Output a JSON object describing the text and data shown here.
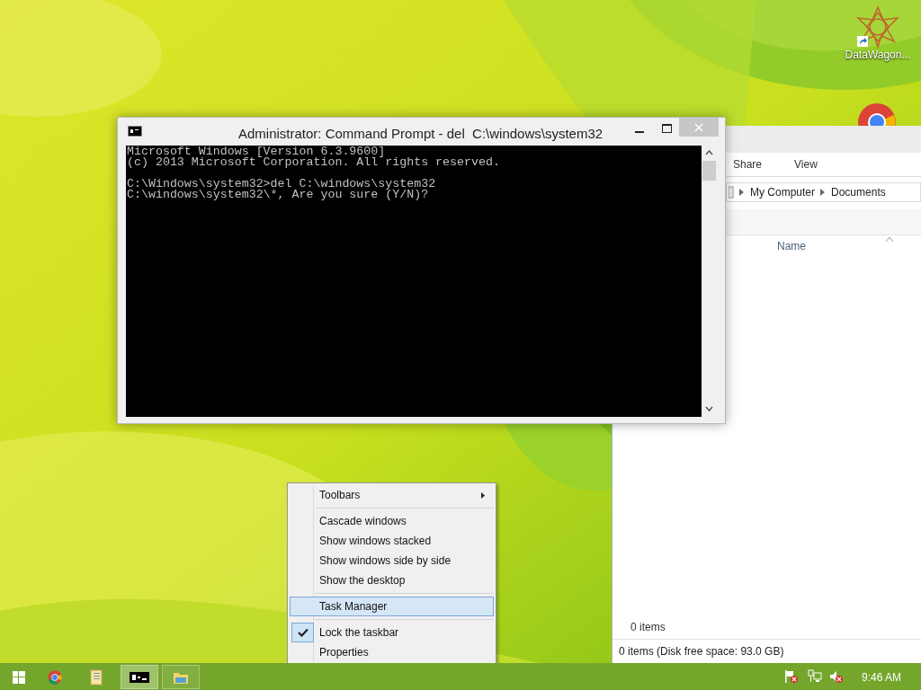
{
  "desktop": {
    "icons": [
      {
        "kind": "datawagon",
        "label": "DataWagon..."
      },
      {
        "kind": "chrome"
      }
    ]
  },
  "cmd_window": {
    "title": "Administrator: Command Prompt - del  C:\\windows\\system32",
    "blocks": [
      [
        "Microsoft Windows [Version 6.3.9600]",
        "(c) 2013 Microsoft Corporation. All rights reserved."
      ],
      [
        "C:\\Windows\\system32>del C:\\windows\\system32",
        "C:\\windows\\system32\\*, Are you sure (Y/N)?"
      ]
    ]
  },
  "explorer_window": {
    "ribbon_tabs": [
      {
        "label": "Share",
        "selected": false
      },
      {
        "label": "View",
        "selected": false
      }
    ],
    "breadcrumb": [
      "My Computer",
      "Documents"
    ],
    "column_header": "Name",
    "item_count": "0 items",
    "status_bar": "0 items (Disk free space: 93.0 GB)"
  },
  "context_menu": {
    "items": [
      {
        "kind": "submenu",
        "label": "Toolbars",
        "selected": false,
        "checked": false
      },
      {
        "kind": "separator"
      },
      {
        "kind": "item",
        "label": "Cascade windows",
        "selected": false,
        "checked": false
      },
      {
        "kind": "item",
        "label": "Show windows stacked",
        "selected": false,
        "checked": false
      },
      {
        "kind": "item",
        "label": "Show windows side by side",
        "selected": false,
        "checked": false
      },
      {
        "kind": "item",
        "label": "Show the desktop",
        "selected": false,
        "checked": false
      },
      {
        "kind": "separator"
      },
      {
        "kind": "item",
        "label": "Task Manager",
        "selected": true,
        "checked": false
      },
      {
        "kind": "separator"
      },
      {
        "kind": "item",
        "label": "Lock the taskbar",
        "selected": false,
        "checked": true
      },
      {
        "kind": "item",
        "label": "Properties",
        "selected": false,
        "checked": false
      }
    ]
  },
  "taskbar": {
    "buttons": [
      {
        "kind": "start",
        "selected": false
      },
      {
        "kind": "chrome",
        "selected": false
      },
      {
        "kind": "files",
        "selected": false
      },
      {
        "kind": "cmd",
        "selected": true
      },
      {
        "kind": "explorer",
        "selected": false
      }
    ],
    "tray": [
      {
        "kind": "flag"
      },
      {
        "kind": "network"
      },
      {
        "kind": "volume"
      }
    ],
    "clock": "9:46 AM"
  }
}
